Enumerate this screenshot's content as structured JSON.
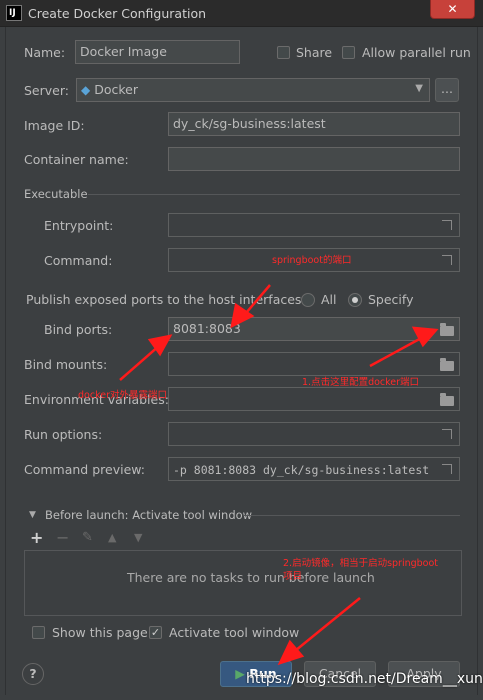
{
  "window": {
    "title": "Create Docker Configuration",
    "close_glyph": "✕",
    "logo": "IJ"
  },
  "form": {
    "name_label": "Name:",
    "name_value": "Docker Image",
    "share_label": "Share",
    "parallel_label": "Allow parallel run",
    "server_label": "Server:",
    "server_value": "Docker",
    "server_more": "...",
    "image_id_label": "Image ID:",
    "image_id_value": "dy_ck/sg-business:latest",
    "container_name_label": "Container name:",
    "executable_label": "Executable",
    "entrypoint_label": "Entrypoint:",
    "command_label": "Command:",
    "publish_label": "Publish exposed ports to the host interfaces:",
    "radio_all": "All",
    "radio_specify": "Specify",
    "bind_ports_label": "Bind ports:",
    "bind_ports_value": "8081:8083",
    "bind_mounts_label": "Bind mounts:",
    "env_vars_label": "Environment variables:",
    "run_options_label": "Run options:",
    "command_preview_label": "Command preview:",
    "command_preview_value": "-p 8081:8083 dy_ck/sg-business:latest"
  },
  "before_launch": {
    "title": "Before launch: Activate tool window",
    "empty_text": "There are no tasks to run before launch",
    "show_page_label": "Show this page",
    "activate_label": "Activate tool window"
  },
  "toolbar": {
    "add": "+",
    "remove": "−"
  },
  "footer": {
    "help": "?",
    "run_label": "Run",
    "cancel_label": "Cancel",
    "apply_label": "Apply"
  },
  "annotations": {
    "springboot_port": "springboot的端口",
    "docker_port": "docker对外暴露端口",
    "click_config": "1.点击这里配置docker端口",
    "start_image_line1": "2.启动镜像，相当于启动springboot",
    "start_image_line2": "项目",
    "watermark": "https://blog.csdn.net/Dream__xun"
  }
}
